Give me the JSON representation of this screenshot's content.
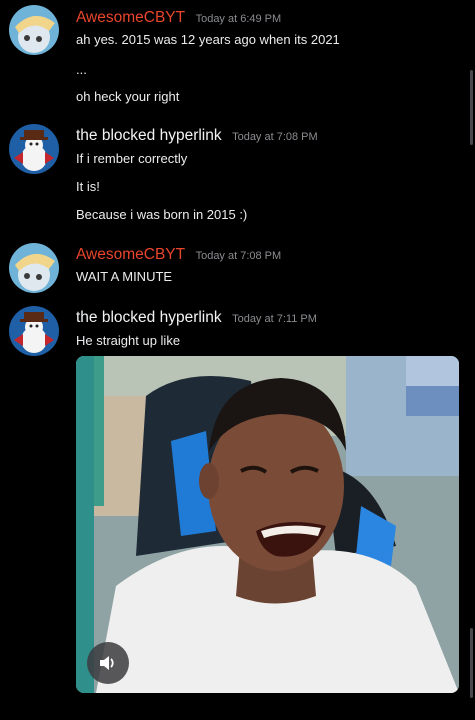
{
  "colors": {
    "background": "#000000",
    "awesome_name": "#e8452c",
    "blocked_name": "#f2f3f5",
    "timestamp": "#8a8c90",
    "message_text": "#ececee"
  },
  "messages": [
    {
      "author": "AwesomeCBYT",
      "timestamp": "Today at 6:49 PM",
      "avatar_icon": "umbrella-cat-avatar-icon",
      "lines": [
        "ah yes. 2015 was 12 years ago when its 2021",
        "...",
        "oh heck your right"
      ]
    },
    {
      "author": "the blocked hyperlink",
      "timestamp": "Today at 7:08 PM",
      "avatar_icon": "snowman-avatar-icon",
      "lines": [
        "If i rember correctly",
        "It is!",
        "Because i was born in 2015 :)"
      ]
    },
    {
      "author": "AwesomeCBYT",
      "timestamp": "Today at 7:08 PM",
      "avatar_icon": "umbrella-cat-avatar-icon",
      "lines": [
        "WAIT A MINUTE"
      ]
    },
    {
      "author": "the blocked hyperlink",
      "timestamp": "Today at 7:11 PM",
      "avatar_icon": "snowman-avatar-icon",
      "lines": [
        "He straight up like"
      ]
    }
  ],
  "embed": {
    "type": "video",
    "description_icon": "laughing-man-video-thumbnail",
    "volume_icon": "volume-icon"
  }
}
